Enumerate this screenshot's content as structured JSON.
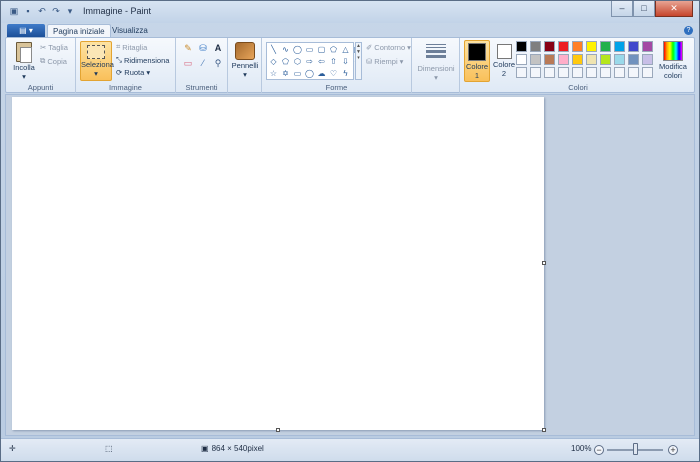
{
  "window": {
    "title": "Immagine - Paint",
    "minimize_icon": "minimize-icon",
    "maximize_icon": "maximize-icon",
    "close_icon": "close-icon"
  },
  "tabs": {
    "file_icon": "paint-menu-icon",
    "items": [
      {
        "label": "Pagina iniziale",
        "active": true
      },
      {
        "label": "Visualizza",
        "active": false
      }
    ]
  },
  "ribbon": {
    "appunti": {
      "label": "Appunti",
      "paste": "Incolla",
      "cut": "Taglia",
      "copy": "Copia"
    },
    "immagine": {
      "label": "Immagine",
      "select": "Seleziona",
      "crop": "Ritaglia",
      "resize": "Ridimensiona",
      "rotate": "Ruota"
    },
    "strumenti": {
      "label": "Strumenti"
    },
    "pennelli": {
      "label": "Pennelli"
    },
    "forme": {
      "label": "Forme",
      "outline": "Contorno",
      "fill": "Riempi"
    },
    "dimensioni": {
      "label": "Dimensioni"
    },
    "colori": {
      "label": "Colori",
      "color1_label": "Colore",
      "color1_num": "1",
      "color2_label": "Colore",
      "color2_num": "2",
      "edit_label": "Modifica",
      "edit_label2": "colori",
      "color1_value": "#000000",
      "color2_value": "#ffffff",
      "palette": [
        "#000000",
        "#7f7f7f",
        "#880015",
        "#ed1c24",
        "#ff7f27",
        "#fff200",
        "#22b14c",
        "#00a2e8",
        "#3f48cc",
        "#a349a4",
        "#ffffff",
        "#c3c3c3",
        "#b97a57",
        "#ffaec9",
        "#ffc90e",
        "#efe4b0",
        "#b5e61d",
        "#99d9ea",
        "#7092be",
        "#c8bfe7",
        "#f3f6fb",
        "#f3f6fb",
        "#f3f6fb",
        "#f3f6fb",
        "#f3f6fb",
        "#f3f6fb",
        "#f3f6fb",
        "#f3f6fb",
        "#f3f6fb",
        "#f3f6fb"
      ]
    }
  },
  "status": {
    "canvas_size": "864 × 540pixel",
    "zoom": "100%"
  }
}
